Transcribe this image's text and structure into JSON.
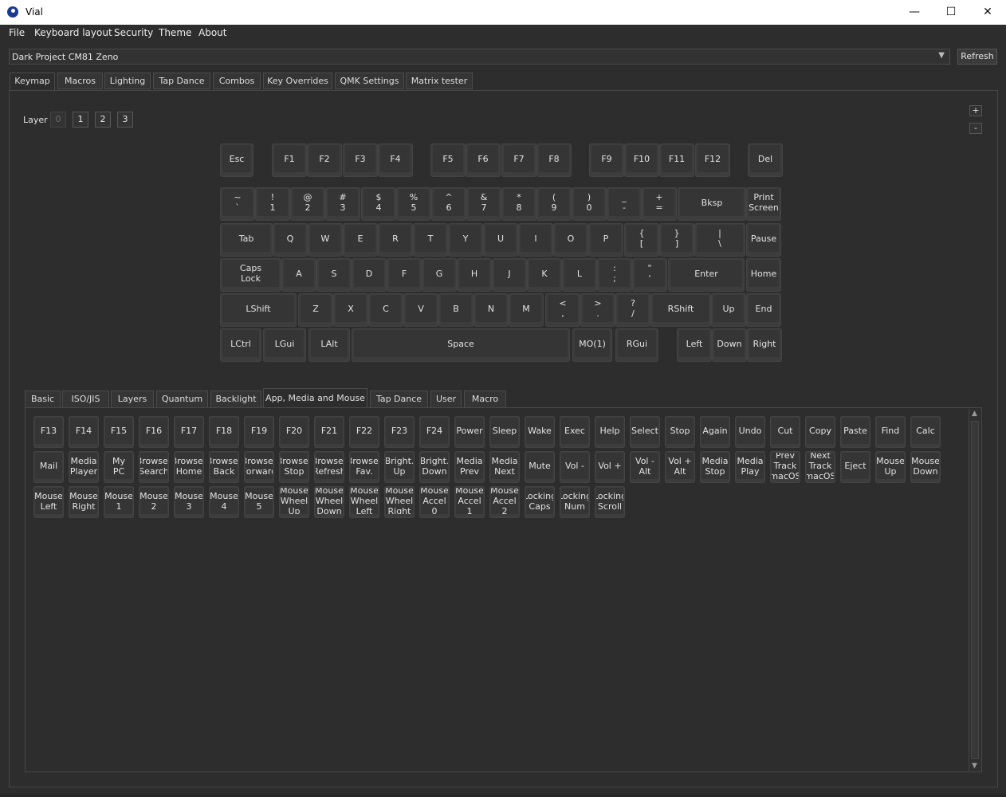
{
  "window": {
    "title": "Vial",
    "minimize": "—",
    "maximize": "☐",
    "close": "✕"
  },
  "menu": [
    "File",
    "Keyboard layout",
    "Security",
    "Theme",
    "About"
  ],
  "device": {
    "selected": "Dark Project CM81 Zeno",
    "refresh_label": "Refresh"
  },
  "tabs": [
    "Keymap",
    "Macros",
    "Lighting",
    "Tap Dance",
    "Combos",
    "Key Overrides",
    "QMK Settings",
    "Matrix tester"
  ],
  "active_tab": "Keymap",
  "layers": {
    "label": "Layer",
    "items": [
      "0",
      "1",
      "2",
      "3"
    ],
    "selected": "0"
  },
  "zoom": {
    "plus": "+",
    "minus": "-"
  },
  "keyboard": {
    "rows": [
      [
        "Esc",
        "F1",
        "F2",
        "F3",
        "F4",
        "F5",
        "F6",
        "F7",
        "F8",
        "F9",
        "F10",
        "F11",
        "F12",
        "Del"
      ],
      [
        "~\n`",
        "!\n1",
        "@\n2",
        "#\n3",
        "$\n4",
        "%\n5",
        "^\n6",
        "&\n7",
        "*\n8",
        "(\n9",
        ")\n0",
        "_\n-",
        "+\n=",
        "Bksp",
        "Print\nScreen"
      ],
      [
        "Tab",
        "Q",
        "W",
        "E",
        "R",
        "T",
        "Y",
        "U",
        "I",
        "O",
        "P",
        "{\n[",
        "}\n]",
        "|\n\\",
        "Pause"
      ],
      [
        "Caps\nLock",
        "A",
        "S",
        "D",
        "F",
        "G",
        "H",
        "J",
        "K",
        "L",
        ":\n;",
        "\"\n'",
        "Enter",
        "Home"
      ],
      [
        "LShift",
        "Z",
        "X",
        "C",
        "V",
        "B",
        "N",
        "M",
        "<\n,",
        ">\n.",
        "?\n/",
        "RShift",
        "Up",
        "End"
      ],
      [
        "LCtrl",
        "LGui",
        "LAlt",
        "Space",
        "MO(1)",
        "RGui",
        "Left",
        "Down",
        "Right"
      ]
    ]
  },
  "keycode_tabs": [
    "Basic",
    "ISO/JIS",
    "Layers",
    "Quantum",
    "Backlight",
    "App, Media and Mouse",
    "Tap Dance",
    "User",
    "Macro"
  ],
  "active_keycode_tab": "App, Media and Mouse",
  "keycodes": [
    "F13",
    "F14",
    "F15",
    "F16",
    "F17",
    "F18",
    "F19",
    "F20",
    "F21",
    "F22",
    "F23",
    "F24",
    "Power",
    "Sleep",
    "Wake",
    "Exec",
    "Help",
    "Select",
    "Stop",
    "Again",
    "Undo",
    "Cut",
    "Copy",
    "Paste",
    "Find",
    "Calc",
    "Mail",
    "Media\nPlayer",
    "My\nPC",
    "Browser\nSearch",
    "Browser\nHome",
    "Browser\nBack",
    "Browser\nForward",
    "Browser\nStop",
    "Browser\nRefresh",
    "Browser\nFav.",
    "Bright.\nUp",
    "Bright.\nDown",
    "Media\nPrev",
    "Media\nNext",
    "Mute",
    "Vol -",
    "Vol +",
    "Vol -\nAlt",
    "Vol +\nAlt",
    "Media\nStop",
    "Media\nPlay",
    "Prev\nTrack\n(macOS)",
    "Next\nTrack\n(macOS)",
    "Eject",
    "Mouse\nUp",
    "Mouse\nDown",
    "Mouse\nLeft",
    "Mouse\nRight",
    "Mouse\n1",
    "Mouse\n2",
    "Mouse\n3",
    "Mouse\n4",
    "Mouse\n5",
    "Mouse\nWheel\nUp",
    "Mouse\nWheel\nDown",
    "Mouse\nWheel\nLeft",
    "Mouse\nWheel\nRight",
    "Mouse\nAccel\n0",
    "Mouse\nAccel\n1",
    "Mouse\nAccel\n2",
    "Locking\nCaps",
    "Locking\nNum",
    "Locking\nScroll"
  ]
}
